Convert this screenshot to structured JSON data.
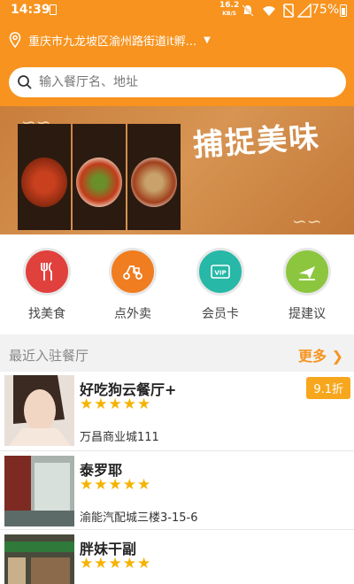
{
  "status_bar": {
    "time": "14:39",
    "net_speed": "16.2",
    "net_unit": "KB/S",
    "battery": "75%"
  },
  "header": {
    "location": "重庆市九龙坡区渝州路街道it孵...",
    "search_placeholder": "输入餐厅名、地址"
  },
  "banner": {
    "slogan": "捕捉美味"
  },
  "categories": [
    {
      "label": "找美食",
      "icon": "fork-knife-icon",
      "color": "#e0413d"
    },
    {
      "label": "点外卖",
      "icon": "scooter-icon",
      "color": "#f07d1f"
    },
    {
      "label": "会员卡",
      "icon": "vip-card-icon",
      "color": "#27b8a7"
    },
    {
      "label": "提建议",
      "icon": "paper-plane-icon",
      "color": "#8cc63e"
    }
  ],
  "recent": {
    "title": "最近入驻餐厅",
    "more": "更多"
  },
  "restaurants": [
    {
      "name": "好吃狗云餐厅+",
      "rating": 5,
      "address": "万昌商业城111",
      "discount": "9.1折"
    },
    {
      "name": "泰罗耶",
      "rating": 5,
      "address": "渝能汽配城三楼3-15-6"
    },
    {
      "name": "胖妹干副",
      "rating": 5,
      "address": ""
    }
  ],
  "colors": {
    "accent": "#f7931e",
    "star": "#f5b301"
  }
}
